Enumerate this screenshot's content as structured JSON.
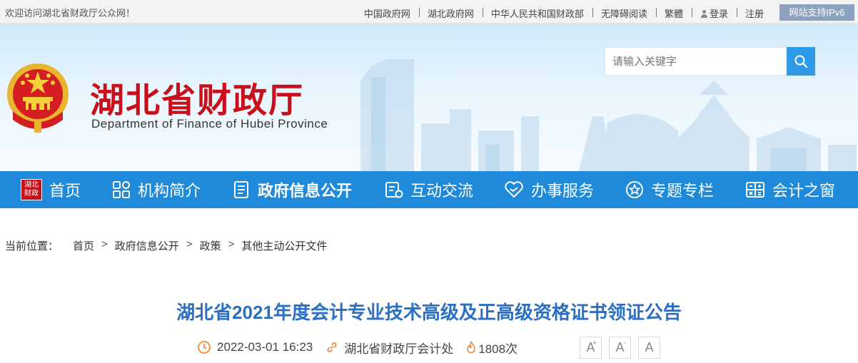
{
  "topbar": {
    "welcome": "欢迎访问湖北省财政厅公众网！",
    "links": [
      "中国政府网",
      "湖北政府网",
      "中华人民共和国财政部",
      "无障碍阅读",
      "繁體",
      "登录",
      "注册"
    ],
    "ipv6": "网站支持IPv6"
  },
  "header": {
    "title": "湖北省财政厅",
    "subtitle": "Department of Finance of Hubei Province",
    "search_placeholder": "请输入关键字"
  },
  "nav": {
    "home_badge": [
      "湖北",
      "财政"
    ],
    "items": [
      "首页",
      "机构简介",
      "政府信息公开",
      "互动交流",
      "办事服务",
      "专题专栏",
      "会计之窗"
    ],
    "active": "政府信息公开"
  },
  "breadcrumb": {
    "label": "当前位置：",
    "items": [
      "首页",
      "政府信息公开",
      "政策",
      "其他主动公开文件"
    ],
    "separator": ">"
  },
  "article": {
    "title": "湖北省2021年度会计专业技术高级及正高级资格证书领证公告",
    "date": "2022-03-01 16:23",
    "source": "湖北省财政厅会计处",
    "views": "1808次",
    "font_buttons": [
      "A",
      "A",
      "A"
    ],
    "font_marks": [
      "+",
      "-"
    ]
  },
  "colors": {
    "nav_bg": "#1f8ad9",
    "title_red": "#c8101c",
    "article_title": "#2b6fc2",
    "meta_icon": "#f08a3c"
  }
}
